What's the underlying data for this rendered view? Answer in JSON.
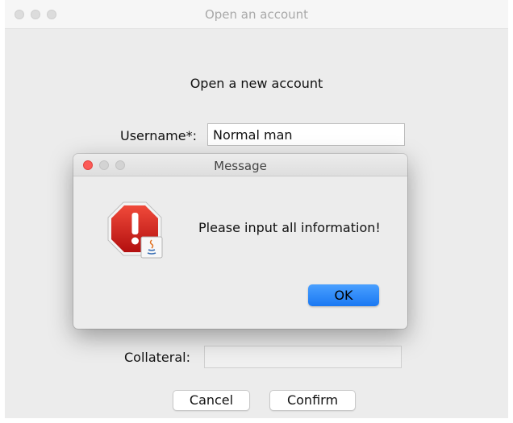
{
  "window": {
    "title": "Open an account",
    "heading": "Open a new account"
  },
  "form": {
    "username_label": "Username*:",
    "username_value": "Normal man",
    "collateral_label": "Collateral:",
    "collateral_value": ""
  },
  "buttons": {
    "cancel": "Cancel",
    "confirm": "Confirm"
  },
  "dialog": {
    "title": "Message",
    "message": "Please input all information!",
    "ok": "OK",
    "icon": "java-warning-icon"
  },
  "colors": {
    "accent": "#1a78f2",
    "close_red": "#fc5b57",
    "warning_red": "#d81f1f"
  }
}
